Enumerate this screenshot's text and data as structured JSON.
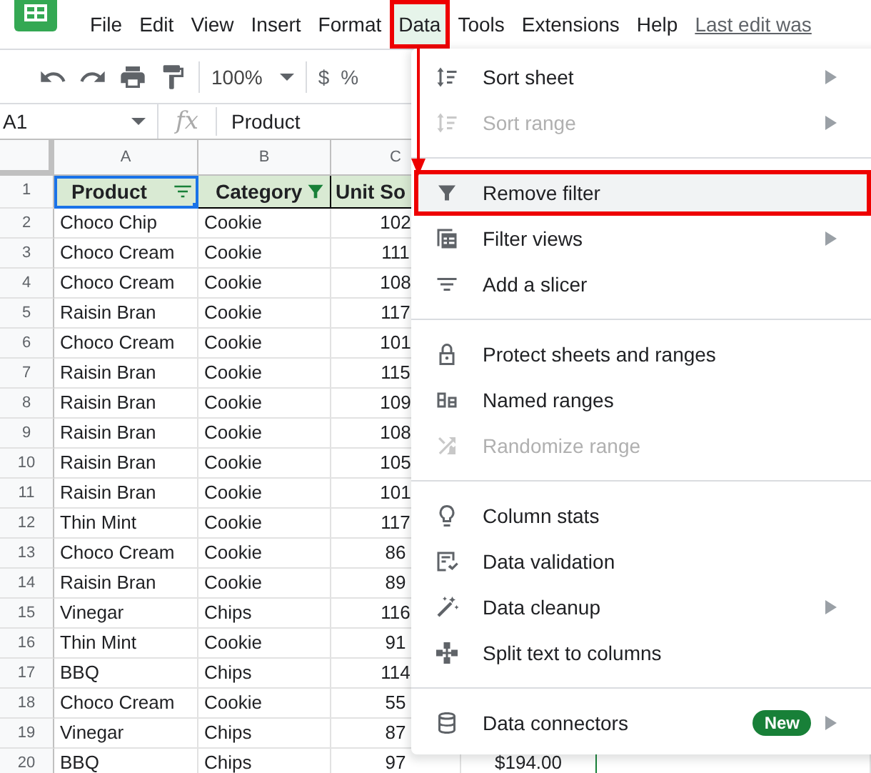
{
  "menubar": {
    "items": [
      {
        "label": "File",
        "selected": false,
        "annotated": false
      },
      {
        "label": "Edit",
        "selected": false,
        "annotated": false
      },
      {
        "label": "View",
        "selected": false,
        "annotated": false
      },
      {
        "label": "Insert",
        "selected": false,
        "annotated": false
      },
      {
        "label": "Format",
        "selected": false,
        "annotated": false
      },
      {
        "label": "Data",
        "selected": true,
        "annotated": true
      },
      {
        "label": "Tools",
        "selected": false,
        "annotated": false
      },
      {
        "label": "Extensions",
        "selected": false,
        "annotated": false
      },
      {
        "label": "Help",
        "selected": false,
        "annotated": false
      }
    ],
    "last_edit": "Last edit was"
  },
  "toolbar": {
    "zoom": "100%",
    "currency": "$",
    "percent": "%"
  },
  "formula_bar": {
    "cell_ref": "A1",
    "fx": "fx",
    "value": "Product"
  },
  "sheet": {
    "columns": [
      "A",
      "B",
      "C"
    ],
    "header_row": {
      "number": "1",
      "cells": [
        {
          "text": "Product",
          "filter_active": false
        },
        {
          "text": "Category",
          "filter_active": true
        },
        {
          "text": "Unit So"
        }
      ]
    },
    "rows": [
      {
        "number": "2",
        "product": "Choco Chip",
        "category": "Cookie",
        "units": "102"
      },
      {
        "number": "3",
        "product": "Choco Cream",
        "category": "Cookie",
        "units": "111"
      },
      {
        "number": "4",
        "product": "Choco Cream",
        "category": "Cookie",
        "units": "108"
      },
      {
        "number": "5",
        "product": "Raisin Bran",
        "category": "Cookie",
        "units": "117"
      },
      {
        "number": "6",
        "product": "Choco Cream",
        "category": "Cookie",
        "units": "101"
      },
      {
        "number": "7",
        "product": "Raisin Bran",
        "category": "Cookie",
        "units": "115"
      },
      {
        "number": "8",
        "product": "Raisin Bran",
        "category": "Cookie",
        "units": "109"
      },
      {
        "number": "9",
        "product": "Raisin Bran",
        "category": "Cookie",
        "units": "108"
      },
      {
        "number": "10",
        "product": "Raisin Bran",
        "category": "Cookie",
        "units": "105"
      },
      {
        "number": "11",
        "product": "Raisin Bran",
        "category": "Cookie",
        "units": "101"
      },
      {
        "number": "12",
        "product": "Thin Mint",
        "category": "Cookie",
        "units": "117"
      },
      {
        "number": "13",
        "product": "Choco Cream",
        "category": "Cookie",
        "units": "86"
      },
      {
        "number": "14",
        "product": "Raisin Bran",
        "category": "Cookie",
        "units": "89"
      },
      {
        "number": "15",
        "product": "Vinegar",
        "category": "Chips",
        "units": "116"
      },
      {
        "number": "16",
        "product": "Thin Mint",
        "category": "Cookie",
        "units": "91"
      },
      {
        "number": "17",
        "product": "BBQ",
        "category": "Chips",
        "units": "114"
      },
      {
        "number": "18",
        "product": "Choco Cream",
        "category": "Cookie",
        "units": "55"
      },
      {
        "number": "19",
        "product": "Vinegar",
        "category": "Chips",
        "units": "87"
      },
      {
        "number": "20",
        "product": "BBQ",
        "category": "Chips",
        "units": "97",
        "column_4": "$194.00"
      }
    ]
  },
  "data_menu": {
    "sections": [
      [
        {
          "label": "Sort sheet",
          "disabled": false,
          "submenu": true,
          "selected": false,
          "annotated": false
        },
        {
          "label": "Sort range",
          "disabled": true,
          "submenu": true,
          "selected": false,
          "annotated": false
        }
      ],
      [
        {
          "label": "Remove filter",
          "disabled": false,
          "submenu": false,
          "selected": true,
          "annotated": true
        },
        {
          "label": "Filter views",
          "disabled": false,
          "submenu": true,
          "selected": false,
          "annotated": false
        },
        {
          "label": "Add a slicer",
          "disabled": false,
          "submenu": false,
          "selected": false,
          "annotated": false
        }
      ],
      [
        {
          "label": "Protect sheets and ranges",
          "disabled": false,
          "submenu": false,
          "selected": false,
          "annotated": false
        },
        {
          "label": "Named ranges",
          "disabled": false,
          "submenu": false,
          "selected": false,
          "annotated": false
        },
        {
          "label": "Randomize range",
          "disabled": true,
          "submenu": false,
          "selected": false,
          "annotated": false
        }
      ],
      [
        {
          "label": "Column stats",
          "disabled": false,
          "submenu": false,
          "selected": false,
          "annotated": false
        },
        {
          "label": "Data validation",
          "disabled": false,
          "submenu": false,
          "selected": false,
          "annotated": false
        },
        {
          "label": "Data cleanup",
          "disabled": false,
          "submenu": true,
          "selected": false,
          "annotated": false
        },
        {
          "label": "Split text to columns",
          "disabled": false,
          "submenu": false,
          "selected": false,
          "annotated": false
        }
      ],
      [
        {
          "label": "Data connectors",
          "disabled": false,
          "submenu": true,
          "selected": false,
          "annotated": false,
          "badge": "New"
        }
      ]
    ]
  }
}
